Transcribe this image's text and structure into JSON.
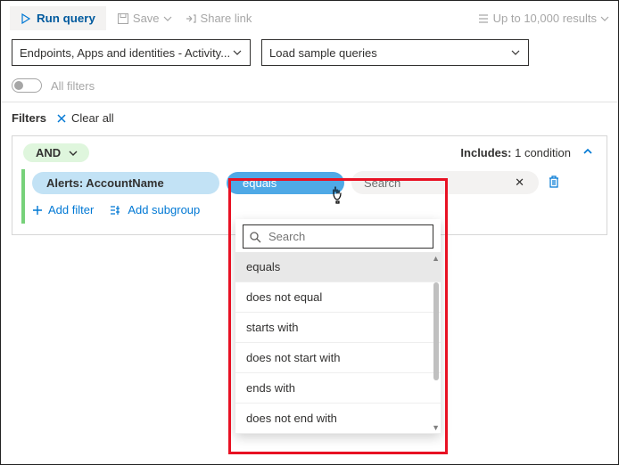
{
  "toolbar": {
    "run": "Run query",
    "save": "Save",
    "share": "Share link",
    "results_limit": "Up to 10,000 results"
  },
  "query_dropdowns": {
    "scope": "Endpoints, Apps and identities - Activity...",
    "sample": "Load sample queries"
  },
  "filters_toggle": {
    "label": "All filters"
  },
  "filters_header": {
    "title": "Filters",
    "clear": "Clear all"
  },
  "panel": {
    "logic": "AND",
    "includes_label": "Includes:",
    "includes_count": "1 condition",
    "condition": {
      "field": "Alerts: AccountName",
      "operator": "equals",
      "value_placeholder": "Search"
    },
    "add_filter": "Add filter",
    "add_subgroup": "Add subgroup"
  },
  "op_popup": {
    "search_placeholder": "Search",
    "options": [
      "equals",
      "does not equal",
      "starts with",
      "does not start with",
      "ends with",
      "does not end with"
    ]
  }
}
